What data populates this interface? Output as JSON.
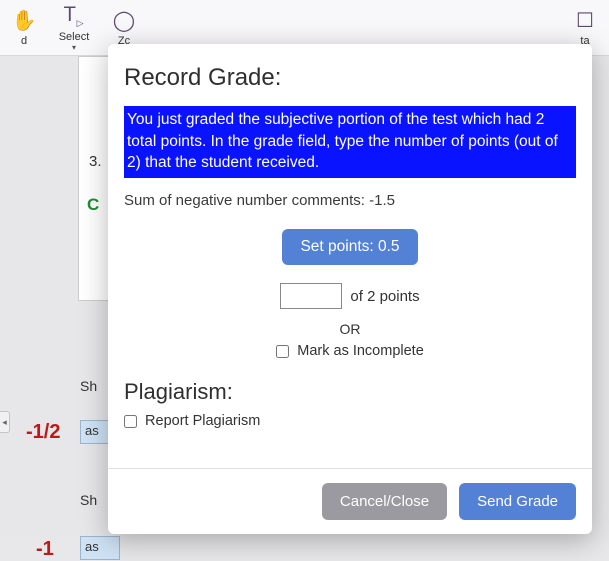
{
  "toolbar": {
    "items": [
      {
        "label": "d"
      },
      {
        "label": "Select"
      },
      {
        "label": "Zc"
      },
      {
        "label": "ta"
      }
    ]
  },
  "background": {
    "question_num": "3.",
    "answer_letter": "C",
    "short_label_1": "Sh",
    "short_label_2": "Sh",
    "score1": "-1/2",
    "score2": "-1",
    "as_text": "as"
  },
  "dialog": {
    "title": "Record Grade:",
    "message": "You just graded the subjective portion of the test which had 2 total points. In the grade field, type the number of points (out of 2) that the student received.",
    "sum_line": "Sum of negative number comments: -1.5",
    "set_points_label": "Set points: 0.5",
    "points_input": "",
    "of_points": "of 2 points",
    "or_text": "OR",
    "mark_incomplete": "Mark as Incomplete",
    "plag_title": "Plagiarism:",
    "report_plag": "Report Plagiarism",
    "cancel_label": "Cancel/Close",
    "send_label": "Send Grade"
  }
}
